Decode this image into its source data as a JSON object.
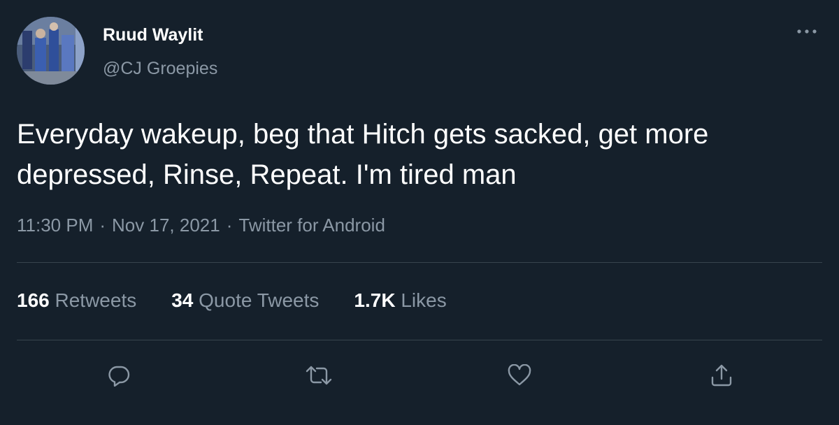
{
  "user": {
    "display_name": "Ruud Waylit",
    "handle": "@CJ Groepies",
    "avatar_icon": "profile-photo"
  },
  "tweet": {
    "text": "Everyday wakeup, beg that Hitch gets sacked, get more depressed, Rinse, Repeat. I'm tired man",
    "time": "11:30 PM",
    "date": "Nov 17, 2021",
    "source": "Twitter for Android",
    "separator": "·"
  },
  "stats": {
    "retweets_count": "166",
    "retweets_label": "Retweets",
    "quotes_count": "34",
    "quotes_label": "Quote Tweets",
    "likes_count": "1.7K",
    "likes_label": "Likes"
  },
  "actions": {
    "reply_icon": "reply-icon",
    "retweet_icon": "retweet-icon",
    "like_icon": "heart-icon",
    "share_icon": "share-icon",
    "more_icon": "more-dots-icon"
  },
  "colors": {
    "background": "#15202b",
    "primary_text": "#ffffff",
    "secondary_text": "#8b98a5",
    "divider": "#38444d"
  }
}
